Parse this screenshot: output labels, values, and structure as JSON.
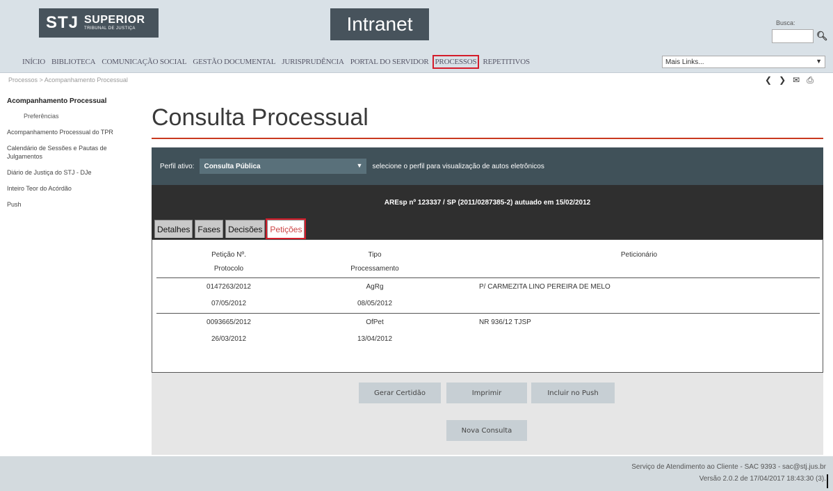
{
  "header": {
    "logo_mark": "STJ",
    "logo_word": "SUPERIOR",
    "logo_sub": "TRIBUNAL DE JUSTIÇA",
    "intranet": "Intranet",
    "busca_label": "Busca:",
    "nav": [
      "INÍCIO",
      "BIBLIOTECA",
      "COMUNICAÇÃO SOCIAL",
      "GESTÃO DOCUMENTAL",
      "JURISPRUDÊNCIA",
      "PORTAL DO SERVIDOR",
      "PROCESSOS",
      "REPETITIVOS"
    ],
    "mais_links": "Mais Links..."
  },
  "breadcrumb": "Processos > Acompanhamento Processual",
  "sidebar": {
    "active": "Acompanhamento Processual",
    "sub": "Preferências",
    "items": [
      "Acompanhamento Processual do TPR",
      "Calendário de Sessões e Pautas de Julgamentos",
      "Diário de Justiça do STJ - DJe",
      "Inteiro Teor do Acórdão",
      "Push"
    ]
  },
  "main": {
    "title": "Consulta Processual",
    "perfil_label": "Perfil ativo:",
    "perfil_value": "Consulta Pública",
    "perfil_hint": "selecione o perfil para visualização de autos eletrônicos",
    "process_title": "AREsp nº 123337 / SP (2011/0287385-2) autuado em 15/02/2012",
    "tabs": [
      "Detalhes",
      "Fases",
      "Decisões",
      "Petições"
    ],
    "table": {
      "headers": {
        "peticao_1": "Petição Nº.",
        "peticao_2": "Protocolo",
        "tipo_1": "Tipo",
        "tipo_2": "Processamento",
        "peticionario": "Peticionário"
      },
      "rows": [
        {
          "numero": "0147263/2012",
          "protocolo": "07/05/2012",
          "tipo": "AgRg",
          "processamento": "08/05/2012",
          "peticionario": "P/ CARMEZITA LINO PEREIRA DE MELO"
        },
        {
          "numero": "0093665/2012",
          "protocolo": "26/03/2012",
          "tipo": "OfPet",
          "processamento": "13/04/2012",
          "peticionario": "NR 936/12 TJSP"
        }
      ]
    },
    "buttons": {
      "certidao": "Gerar Certidão",
      "imprimir": "Imprimir",
      "push": "Incluir no Push",
      "nova": "Nova Consulta"
    }
  },
  "footer": {
    "line1": "Serviço de Atendimento ao Cliente - SAC 9393 - sac@stj.jus.br",
    "line2": "Versão 2.0.2 de 17/04/2017 18:43:30 (3)."
  },
  "colors": {
    "header_bg": "#d9e1e7",
    "logo_bg": "#47535c",
    "accent_red": "#c9391f",
    "highlight_red": "#d41c2a",
    "perfil_bar": "#405159",
    "process_band": "#2f2f2f"
  }
}
